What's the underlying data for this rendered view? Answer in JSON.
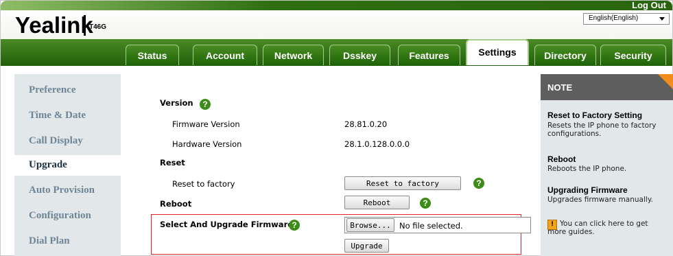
{
  "header": {
    "logo": "Yealink",
    "model": "T46G",
    "logout": "Log Out",
    "language": "English(English)"
  },
  "tabs": [
    {
      "label": "Status"
    },
    {
      "label": "Account"
    },
    {
      "label": "Network"
    },
    {
      "label": "Dsskey"
    },
    {
      "label": "Features"
    },
    {
      "label": "Settings"
    },
    {
      "label": "Directory"
    },
    {
      "label": "Security"
    }
  ],
  "sidebar": {
    "items": [
      {
        "label": "Preference"
      },
      {
        "label": "Time & Date"
      },
      {
        "label": "Call Display"
      },
      {
        "label": "Upgrade"
      },
      {
        "label": "Auto Provision"
      },
      {
        "label": "Configuration"
      },
      {
        "label": "Dial Plan"
      }
    ]
  },
  "main": {
    "version_heading": "Version",
    "firmware_version_label": "Firmware Version",
    "firmware_version_value": "28.81.0.20",
    "hardware_version_label": "Hardware Version",
    "hardware_version_value": "28.1.0.128.0.0.0",
    "reset_heading": "Reset",
    "reset_label": "Reset to factory",
    "reset_button": "Reset to factory",
    "reboot_heading": "Reboot",
    "reboot_button": "Reboot",
    "upgrade_label": "Select And Upgrade Firmware",
    "browse_button": "Browse...",
    "file_status": "No file selected.",
    "upgrade_button": "Upgrade",
    "help_glyph": "?"
  },
  "note": {
    "title": "NOTE",
    "sections": [
      {
        "title": "Reset to Factory Setting",
        "text": "Resets the IP phone to factory configurations."
      },
      {
        "title": "Reboot",
        "text": "Reboots the IP phone."
      },
      {
        "title": "Upgrading Firmware",
        "text": "Upgrades firmware manually."
      }
    ],
    "guide_text": "You can click here to get more guides."
  },
  "colors": {
    "header_green": "#2f6f12",
    "help_green": "#3e8c18",
    "note_header": "#5e5e5e",
    "note_accent": "#f28c1c",
    "highlight_red": "#e52222",
    "sidebar_bg": "#e2e7ea"
  }
}
